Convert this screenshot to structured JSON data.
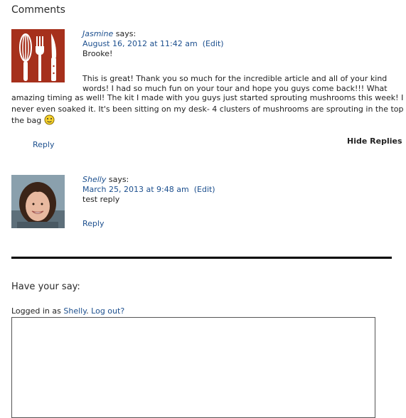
{
  "section_title": "Comments",
  "comments": [
    {
      "author": "Jasmine",
      "says": "says:",
      "date": "August 16, 2012 at 11:42 am",
      "edit": "(Edit)",
      "greeting": "Brooke!",
      "body_line1": "This is great! Thank you so much for the incredible article and all of your kind",
      "body_line2": "words! I had so much fun on your tour and hope you guys come back!!! What",
      "body_line3": "amazing timing as well! The kit I made with you guys just started sprouting mushrooms this week! I",
      "body_line4": "never even soaked it. It's been sitting on my desk- 4 clusters of mushrooms are sprouting in the top of",
      "body_line5": "the bag",
      "reply": "Reply",
      "hide_replies": "Hide Replies",
      "avatar_icon": "utensils-icon"
    },
    {
      "author": "Shelly",
      "says": "says:",
      "date": "March 25, 2013 at 9:48 am",
      "edit": "(Edit)",
      "body": "test reply",
      "reply": "Reply",
      "avatar_icon": "user-photo"
    }
  ],
  "form": {
    "title": "Have your say:",
    "logged_in_prefix": "Logged in as",
    "user": "Shelly",
    "logout": "Log out?",
    "textarea_value": ""
  },
  "colors": {
    "link": "#1c4f8e",
    "avatar_bg": "#a6301c",
    "divider": "#000000"
  }
}
